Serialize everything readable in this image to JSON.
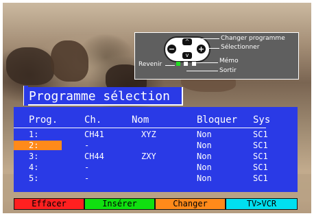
{
  "remote_help": {
    "changer_programme": "Changer programme",
    "selectionner": "Sélectionner",
    "memo": "Mémo",
    "revenir": "Revenir",
    "sortir": "Sortir",
    "minus": "−",
    "plus": "+",
    "up": "^",
    "down": "v"
  },
  "title": "Programme sélection",
  "table": {
    "headers": {
      "prog": "Prog.",
      "ch": "Ch.",
      "nom": "Nom",
      "bloquer": "Bloquer",
      "sys": "Sys"
    },
    "rows": [
      {
        "prog": "1:",
        "ch": "CH41",
        "nom": "XYZ",
        "bloquer": "Non",
        "sys": "SC1"
      },
      {
        "prog": "2:",
        "ch": "-",
        "nom": "",
        "bloquer": "Non",
        "sys": "SC1"
      },
      {
        "prog": "3:",
        "ch": "CH44",
        "nom": "ZXY",
        "bloquer": "Non",
        "sys": "SC1"
      },
      {
        "prog": "4:",
        "ch": "-",
        "nom": "",
        "bloquer": "Non",
        "sys": "SC1"
      },
      {
        "prog": "5:",
        "ch": "-",
        "nom": "",
        "bloquer": "Non",
        "sys": "SC1"
      }
    ],
    "selected_row": 2
  },
  "buttons": {
    "effacer": "Effacer",
    "inserer": "Insérer",
    "changer": "Changer",
    "tvvcr": "TV>VCR"
  },
  "colors": {
    "osd_blue": "#2a3ae6",
    "selection": "#ff8a1a",
    "red": "#ff2020",
    "green": "#10e010",
    "orange": "#ff8a1a",
    "cyan": "#00e0f0"
  }
}
